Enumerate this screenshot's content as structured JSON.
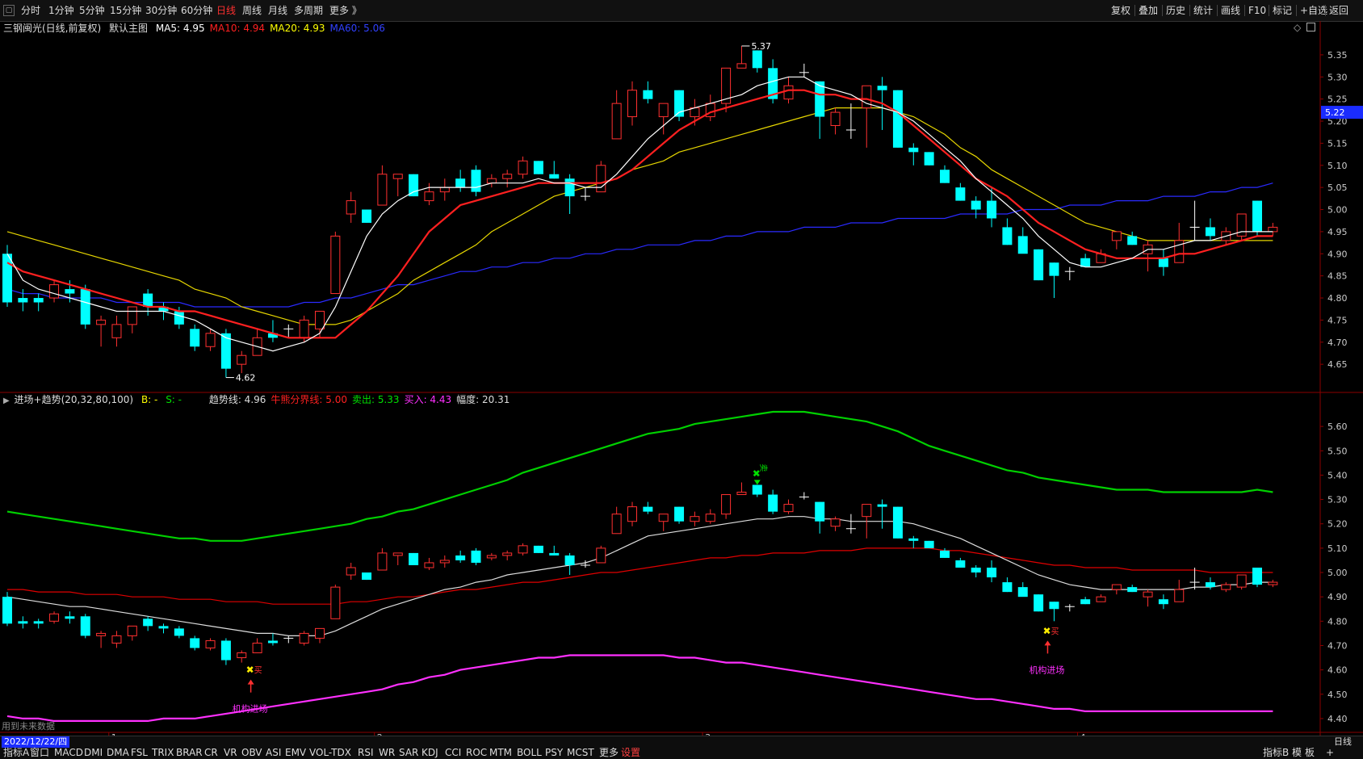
{
  "toolbar": {
    "periods": [
      "分时",
      "1分钟",
      "5分钟",
      "15分钟",
      "30分钟",
      "60分钟",
      "日线",
      "周线",
      "月线",
      "多周期",
      "更多 》"
    ],
    "active_period": "日线",
    "tools": [
      "复权",
      "叠加",
      "历史",
      "统计",
      "画线",
      "F10",
      "标记",
      "+自选",
      "返回"
    ]
  },
  "main_panel": {
    "stock_title": "三钢闽光(日线,前复权)",
    "chart_name": "默认主图",
    "ma_labels": [
      {
        "text": "MA5: 4.95",
        "color": "#ffffff"
      },
      {
        "text": "MA10: 4.94",
        "color": "#ff2020"
      },
      {
        "text": "MA20: 4.93",
        "color": "#ffff00"
      },
      {
        "text": "MA60: 5.06",
        "color": "#3040ff"
      }
    ],
    "price_axis": [
      "5.35",
      "5.30",
      "5.25",
      "5.20",
      "5.15",
      "5.10",
      "5.05",
      "5.00",
      "4.95",
      "4.90",
      "4.85",
      "4.80",
      "4.75",
      "4.70",
      "4.65"
    ],
    "current_price_tag": "5.22",
    "high_label": "5.37",
    "low_label": "4.62"
  },
  "sub_panel": {
    "indicator_title": "进场+趋势(20,32,80,100)",
    "b_label": "B: -",
    "s_label": "S: -",
    "values": [
      {
        "text": "趋势线: 4.96",
        "color": "#dddddd"
      },
      {
        "text": "牛熊分界线: 5.00",
        "color": "#ff2020"
      },
      {
        "text": "卖出: 5.33",
        "color": "#00e000"
      },
      {
        "text": "买入: 4.43",
        "color": "#ff30ff"
      },
      {
        "text": "幅度: 20.31",
        "color": "#dddddd"
      }
    ],
    "price_axis": [
      "5.60",
      "5.50",
      "5.40",
      "5.30",
      "5.20",
      "5.10",
      "5.00",
      "4.90",
      "4.80",
      "4.70",
      "4.60",
      "4.50",
      "4.40"
    ],
    "signals": {
      "buy_mark": "买",
      "sell_mark": "卖",
      "entry_label": "机构进场"
    },
    "footnote": "用到未来数据"
  },
  "month_markers": [
    "1",
    "2",
    "3",
    "4"
  ],
  "bottom": {
    "date": "2022/12/22/四",
    "day_button": "日线",
    "tabs": [
      "指标A",
      "窗口",
      "MACD",
      "DMI",
      "DMA",
      "FSL",
      "TRIX",
      "BRAR",
      "CR",
      "VR",
      "OBV",
      "ASI",
      "EMV",
      "VOL-TDX",
      "RSI",
      "WR",
      "SAR",
      "KDJ",
      "CCI",
      "ROC",
      "MTM",
      "BOLL",
      "PSY",
      "MCST",
      "更多",
      "设置"
    ],
    "right_tabs": [
      "指标B",
      "模",
      "板",
      "+"
    ]
  },
  "chart_data": {
    "type": "candlestick",
    "ohlc": [
      [
        4.9,
        4.92,
        4.78,
        4.79
      ],
      [
        4.8,
        4.82,
        4.77,
        4.79
      ],
      [
        4.8,
        4.81,
        4.77,
        4.79
      ],
      [
        4.8,
        4.84,
        4.79,
        4.83
      ],
      [
        4.82,
        4.84,
        4.79,
        4.81
      ],
      [
        4.82,
        4.83,
        4.73,
        4.74
      ],
      [
        4.74,
        4.76,
        4.69,
        4.75
      ],
      [
        4.71,
        4.76,
        4.69,
        4.74
      ],
      [
        4.74,
        4.78,
        4.72,
        4.78
      ],
      [
        4.81,
        4.82,
        4.76,
        4.78
      ],
      [
        4.78,
        4.79,
        4.75,
        4.77
      ],
      [
        4.77,
        4.78,
        4.73,
        4.74
      ],
      [
        4.73,
        4.74,
        4.68,
        4.69
      ],
      [
        4.69,
        4.73,
        4.68,
        4.72
      ],
      [
        4.72,
        4.73,
        4.62,
        4.64
      ],
      [
        4.65,
        4.68,
        4.63,
        4.67
      ],
      [
        4.67,
        4.73,
        4.67,
        4.71
      ],
      [
        4.72,
        4.75,
        4.7,
        4.71
      ],
      [
        4.73,
        4.74,
        4.71,
        4.73
      ],
      [
        4.71,
        4.76,
        4.7,
        4.75
      ],
      [
        4.73,
        4.77,
        4.71,
        4.77
      ],
      [
        4.81,
        4.95,
        4.81,
        4.94
      ],
      [
        4.99,
        5.04,
        4.97,
        5.02
      ],
      [
        5.0,
        5.0,
        4.97,
        4.97
      ],
      [
        5.01,
        5.1,
        5.01,
        5.08
      ],
      [
        5.07,
        5.08,
        5.03,
        5.08
      ],
      [
        5.08,
        5.08,
        5.03,
        5.03
      ],
      [
        5.02,
        5.06,
        5.01,
        5.04
      ],
      [
        5.04,
        5.07,
        5.02,
        5.05
      ],
      [
        5.07,
        5.09,
        5.04,
        5.05
      ],
      [
        5.09,
        5.1,
        5.03,
        5.04
      ],
      [
        5.06,
        5.08,
        5.05,
        5.07
      ],
      [
        5.07,
        5.09,
        5.05,
        5.08
      ],
      [
        5.08,
        5.12,
        5.07,
        5.11
      ],
      [
        5.11,
        5.11,
        5.08,
        5.08
      ],
      [
        5.08,
        5.11,
        5.07,
        5.07
      ],
      [
        5.07,
        5.08,
        4.99,
        5.03
      ],
      [
        5.03,
        5.05,
        5.02,
        5.03
      ],
      [
        5.04,
        5.11,
        5.04,
        5.1
      ],
      [
        5.16,
        5.27,
        5.16,
        5.24
      ],
      [
        5.21,
        5.29,
        5.19,
        5.27
      ],
      [
        5.27,
        5.29,
        5.24,
        5.25
      ],
      [
        5.21,
        5.24,
        5.17,
        5.24
      ],
      [
        5.27,
        5.27,
        5.2,
        5.21
      ],
      [
        5.21,
        5.25,
        5.19,
        5.23
      ],
      [
        5.21,
        5.26,
        5.2,
        5.24
      ],
      [
        5.24,
        5.32,
        5.22,
        5.32
      ],
      [
        5.32,
        5.37,
        5.32,
        5.33
      ],
      [
        5.36,
        5.36,
        5.31,
        5.32
      ],
      [
        5.32,
        5.34,
        5.24,
        5.25
      ],
      [
        5.25,
        5.3,
        5.24,
        5.28
      ],
      [
        5.31,
        5.33,
        5.3,
        5.31
      ],
      [
        5.29,
        5.29,
        5.16,
        5.21
      ],
      [
        5.19,
        5.23,
        5.17,
        5.22
      ],
      [
        5.18,
        5.24,
        5.16,
        5.18
      ],
      [
        5.23,
        5.28,
        5.14,
        5.28
      ],
      [
        5.28,
        5.3,
        5.18,
        5.27
      ],
      [
        5.27,
        5.27,
        5.14,
        5.14
      ],
      [
        5.14,
        5.15,
        5.1,
        5.13
      ],
      [
        5.13,
        5.13,
        5.1,
        5.1
      ],
      [
        5.09,
        5.1,
        5.06,
        5.06
      ],
      [
        5.05,
        5.06,
        5.02,
        5.02
      ],
      [
        5.02,
        5.03,
        4.98,
        5.0
      ],
      [
        5.02,
        5.05,
        4.96,
        4.98
      ],
      [
        4.96,
        4.98,
        4.92,
        4.92
      ],
      [
        4.94,
        4.96,
        4.91,
        4.9
      ],
      [
        4.91,
        4.91,
        4.84,
        4.84
      ],
      [
        4.88,
        4.88,
        4.8,
        4.85
      ],
      [
        4.86,
        4.87,
        4.84,
        4.86
      ],
      [
        4.89,
        4.9,
        4.87,
        4.87
      ],
      [
        4.88,
        4.91,
        4.88,
        4.9
      ],
      [
        4.93,
        4.95,
        4.91,
        4.95
      ],
      [
        4.94,
        4.95,
        4.92,
        4.92
      ],
      [
        4.9,
        4.93,
        4.86,
        4.92
      ],
      [
        4.89,
        4.91,
        4.85,
        4.87
      ],
      [
        4.88,
        4.97,
        4.88,
        4.93
      ],
      [
        4.96,
        5.02,
        4.93,
        4.96
      ],
      [
        4.96,
        4.98,
        4.93,
        4.94
      ],
      [
        4.93,
        4.96,
        4.92,
        4.95
      ],
      [
        4.94,
        4.99,
        4.93,
        4.99
      ],
      [
        5.02,
        5.02,
        4.94,
        4.95
      ],
      [
        4.95,
        4.97,
        4.94,
        4.96
      ]
    ],
    "ma5": [
      4.9,
      4.84,
      4.82,
      4.81,
      4.8,
      4.79,
      4.78,
      4.77,
      4.77,
      4.77,
      4.77,
      4.76,
      4.75,
      4.73,
      4.71,
      4.7,
      4.69,
      4.68,
      4.69,
      4.7,
      4.72,
      4.78,
      4.86,
      4.94,
      4.99,
      5.02,
      5.04,
      5.05,
      5.05,
      5.05,
      5.05,
      5.06,
      5.06,
      5.06,
      5.07,
      5.06,
      5.06,
      5.05,
      5.05,
      5.08,
      5.12,
      5.16,
      5.19,
      5.22,
      5.23,
      5.24,
      5.25,
      5.26,
      5.28,
      5.29,
      5.3,
      5.3,
      5.28,
      5.27,
      5.26,
      5.24,
      5.23,
      5.22,
      5.2,
      5.17,
      5.14,
      5.11,
      5.07,
      5.04,
      5.01,
      4.98,
      4.94,
      4.91,
      4.88,
      4.87,
      4.87,
      4.88,
      4.89,
      4.91,
      4.91,
      4.92,
      4.93,
      4.93,
      4.94,
      4.95,
      4.95,
      4.95
    ],
    "ma10": [
      4.88,
      4.86,
      4.85,
      4.84,
      4.83,
      4.82,
      4.81,
      4.8,
      4.79,
      4.78,
      4.78,
      4.77,
      4.77,
      4.76,
      4.75,
      4.74,
      4.73,
      4.72,
      4.71,
      4.71,
      4.71,
      4.71,
      4.74,
      4.77,
      4.81,
      4.85,
      4.9,
      4.95,
      4.98,
      5.01,
      5.02,
      5.03,
      5.04,
      5.05,
      5.06,
      5.06,
      5.06,
      5.06,
      5.06,
      5.07,
      5.09,
      5.12,
      5.15,
      5.18,
      5.2,
      5.22,
      5.23,
      5.24,
      5.25,
      5.26,
      5.27,
      5.27,
      5.26,
      5.26,
      5.25,
      5.25,
      5.24,
      5.22,
      5.19,
      5.16,
      5.13,
      5.1,
      5.07,
      5.05,
      5.03,
      5.0,
      4.97,
      4.95,
      4.93,
      4.91,
      4.9,
      4.89,
      4.89,
      4.89,
      4.89,
      4.9,
      4.9,
      4.91,
      4.92,
      4.93,
      4.94,
      4.94
    ],
    "ma20": [
      4.95,
      4.94,
      4.93,
      4.92,
      4.91,
      4.9,
      4.89,
      4.88,
      4.87,
      4.86,
      4.85,
      4.84,
      4.82,
      4.81,
      4.8,
      4.78,
      4.77,
      4.76,
      4.75,
      4.74,
      4.74,
      4.74,
      4.75,
      4.77,
      4.79,
      4.81,
      4.84,
      4.86,
      4.88,
      4.9,
      4.92,
      4.95,
      4.97,
      4.99,
      5.01,
      5.03,
      5.04,
      5.05,
      5.06,
      5.07,
      5.09,
      5.1,
      5.11,
      5.13,
      5.14,
      5.15,
      5.16,
      5.17,
      5.18,
      5.19,
      5.2,
      5.21,
      5.22,
      5.23,
      5.23,
      5.23,
      5.23,
      5.22,
      5.21,
      5.19,
      5.17,
      5.14,
      5.12,
      5.09,
      5.07,
      5.05,
      5.03,
      5.01,
      4.99,
      4.97,
      4.96,
      4.95,
      4.94,
      4.93,
      4.93,
      4.93,
      4.93,
      4.93,
      4.93,
      4.93,
      4.93,
      4.93
    ],
    "ma60": [
      4.82,
      4.81,
      4.81,
      4.8,
      4.8,
      4.8,
      4.8,
      4.79,
      4.79,
      4.79,
      4.79,
      4.79,
      4.78,
      4.78,
      4.78,
      4.78,
      4.78,
      4.78,
      4.78,
      4.79,
      4.79,
      4.8,
      4.8,
      4.81,
      4.82,
      4.83,
      4.83,
      4.84,
      4.85,
      4.86,
      4.86,
      4.87,
      4.87,
      4.88,
      4.88,
      4.89,
      4.89,
      4.9,
      4.9,
      4.91,
      4.91,
      4.92,
      4.92,
      4.92,
      4.93,
      4.93,
      4.94,
      4.94,
      4.95,
      4.95,
      4.95,
      4.96,
      4.96,
      4.96,
      4.97,
      4.97,
      4.97,
      4.98,
      4.98,
      4.98,
      4.98,
      4.99,
      4.99,
      4.99,
      4.99,
      5.0,
      5.0,
      5.0,
      5.01,
      5.01,
      5.01,
      5.02,
      5.02,
      5.02,
      5.03,
      5.03,
      5.03,
      5.04,
      5.04,
      5.05,
      5.05,
      5.06
    ],
    "trend_line": [
      4.9,
      4.89,
      4.88,
      4.87,
      4.86,
      4.86,
      4.85,
      4.84,
      4.83,
      4.82,
      4.81,
      4.8,
      4.79,
      4.78,
      4.77,
      4.76,
      4.75,
      4.75,
      4.74,
      4.74,
      4.74,
      4.76,
      4.79,
      4.82,
      4.85,
      4.87,
      4.89,
      4.91,
      4.93,
      4.94,
      4.96,
      4.97,
      4.99,
      5.0,
      5.01,
      5.02,
      5.03,
      5.04,
      5.06,
      5.09,
      5.12,
      5.15,
      5.16,
      5.17,
      5.18,
      5.19,
      5.2,
      5.21,
      5.22,
      5.22,
      5.23,
      5.23,
      5.22,
      5.22,
      5.21,
      5.21,
      5.21,
      5.21,
      5.2,
      5.18,
      5.16,
      5.14,
      5.11,
      5.08,
      5.05,
      5.02,
      4.99,
      4.97,
      4.95,
      4.94,
      4.93,
      4.93,
      4.93,
      4.93,
      4.93,
      4.93,
      4.94,
      4.94,
      4.95,
      4.95,
      4.96,
      4.96
    ],
    "bull_bear_line": [
      4.93,
      4.93,
      4.92,
      4.92,
      4.92,
      4.91,
      4.91,
      4.91,
      4.9,
      4.9,
      4.9,
      4.89,
      4.89,
      4.89,
      4.88,
      4.88,
      4.88,
      4.87,
      4.87,
      4.87,
      4.87,
      4.87,
      4.88,
      4.88,
      4.89,
      4.9,
      4.9,
      4.91,
      4.92,
      4.93,
      4.93,
      4.94,
      4.95,
      4.96,
      4.96,
      4.97,
      4.98,
      4.99,
      5.0,
      5.0,
      5.01,
      5.02,
      5.03,
      5.04,
      5.05,
      5.06,
      5.06,
      5.07,
      5.07,
      5.08,
      5.08,
      5.08,
      5.09,
      5.09,
      5.09,
      5.1,
      5.1,
      5.1,
      5.1,
      5.1,
      5.09,
      5.09,
      5.08,
      5.07,
      5.06,
      5.05,
      5.04,
      5.03,
      5.03,
      5.02,
      5.02,
      5.02,
      5.01,
      5.01,
      5.01,
      5.01,
      5.01,
      5.0,
      5.0,
      5.0,
      5.0,
      5.0
    ],
    "sell_line": [
      5.25,
      5.24,
      5.23,
      5.22,
      5.21,
      5.2,
      5.19,
      5.18,
      5.17,
      5.16,
      5.15,
      5.14,
      5.14,
      5.13,
      5.13,
      5.13,
      5.14,
      5.15,
      5.16,
      5.17,
      5.18,
      5.19,
      5.2,
      5.22,
      5.23,
      5.25,
      5.26,
      5.28,
      5.3,
      5.32,
      5.34,
      5.36,
      5.38,
      5.41,
      5.43,
      5.45,
      5.47,
      5.49,
      5.51,
      5.53,
      5.55,
      5.57,
      5.58,
      5.59,
      5.61,
      5.62,
      5.63,
      5.64,
      5.65,
      5.66,
      5.66,
      5.66,
      5.65,
      5.64,
      5.63,
      5.62,
      5.6,
      5.58,
      5.55,
      5.52,
      5.5,
      5.48,
      5.46,
      5.44,
      5.42,
      5.41,
      5.39,
      5.38,
      5.37,
      5.36,
      5.35,
      5.34,
      5.34,
      5.34,
      5.33,
      5.33,
      5.33,
      5.33,
      5.33,
      5.33,
      5.34,
      5.33
    ],
    "buy_line": [
      4.41,
      4.4,
      4.4,
      4.39,
      4.39,
      4.39,
      4.39,
      4.39,
      4.39,
      4.39,
      4.4,
      4.4,
      4.4,
      4.41,
      4.42,
      4.43,
      4.44,
      4.45,
      4.46,
      4.47,
      4.48,
      4.49,
      4.5,
      4.51,
      4.52,
      4.54,
      4.55,
      4.57,
      4.58,
      4.6,
      4.61,
      4.62,
      4.63,
      4.64,
      4.65,
      4.65,
      4.66,
      4.66,
      4.66,
      4.66,
      4.66,
      4.66,
      4.66,
      4.65,
      4.65,
      4.64,
      4.63,
      4.63,
      4.62,
      4.61,
      4.6,
      4.59,
      4.58,
      4.57,
      4.56,
      4.55,
      4.54,
      4.53,
      4.52,
      4.51,
      4.5,
      4.49,
      4.48,
      4.48,
      4.47,
      4.46,
      4.45,
      4.44,
      4.44,
      4.43,
      4.43,
      4.43,
      4.43,
      4.43,
      4.43,
      4.43,
      4.43,
      4.43,
      4.43,
      4.43,
      4.43,
      4.43
    ],
    "main_y_range": [
      4.59,
      5.39
    ],
    "sub_y_range": [
      4.35,
      5.68
    ],
    "signals": [
      {
        "type": "buy",
        "bar": 16,
        "value": 4.6
      },
      {
        "type": "sell",
        "bar": 48,
        "value": 5.42
      },
      {
        "type": "buy",
        "bar": 67,
        "value": 4.76
      }
    ],
    "high_bar": 47,
    "low_bar": 14,
    "month_bars": [
      7,
      24,
      45,
      69
    ],
    "colors": {
      "up": "#ff3030",
      "down": "#00ffff",
      "ma5": "#ffffff",
      "ma10": "#ff2020",
      "ma20": "#e6d600",
      "ma60": "#2a2aff",
      "sell_line": "#00d000",
      "buy_line": "#ff30ff",
      "bull_bear": "#e00000",
      "trend": "#dddddd"
    }
  }
}
